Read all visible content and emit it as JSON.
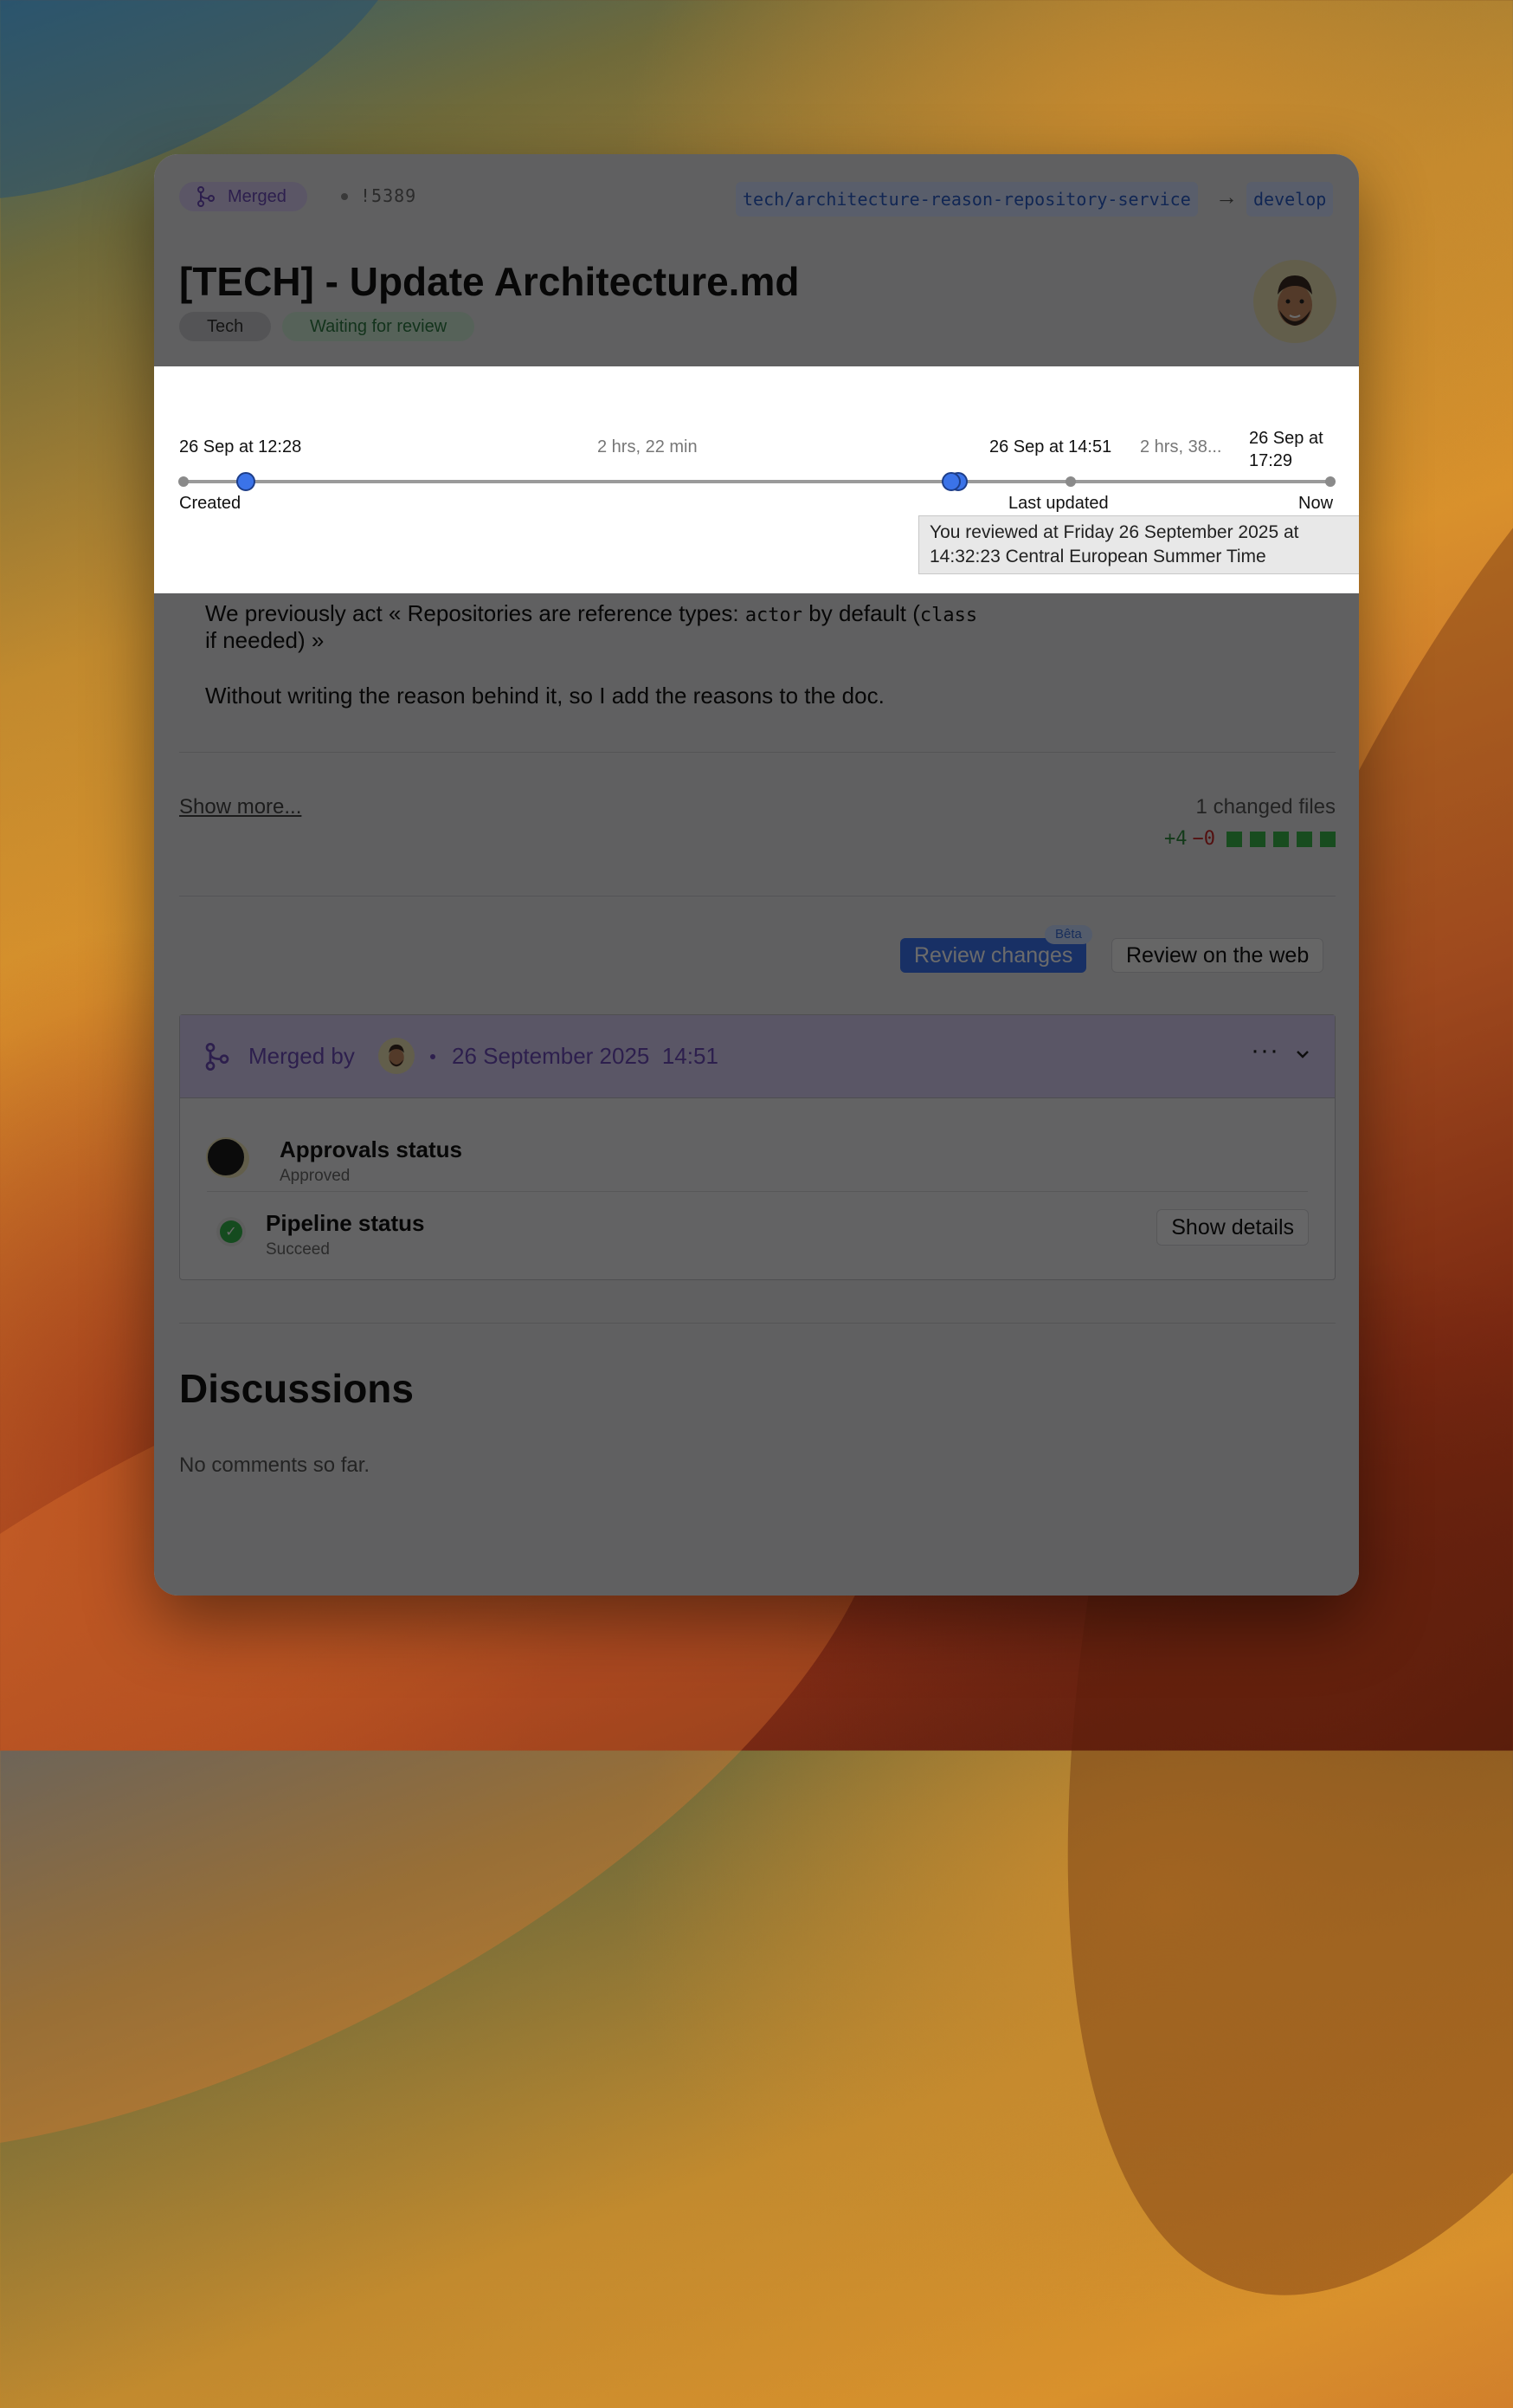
{
  "header": {
    "status": "Merged",
    "mr_id": "!5389",
    "source_branch": "tech/architecture-reason-repository-service",
    "target_branch": "develop"
  },
  "title": "[TECH] - Update Architecture.md",
  "tags": [
    "Tech",
    "Waiting for review"
  ],
  "timeline": {
    "created_time": "26 Sep at 12:28",
    "duration_1": "2 hrs, 22 min",
    "updated_time": "26 Sep at 14:51",
    "duration_2": "2 hrs, 38...",
    "now_time_line1": "26 Sep at",
    "now_time_line2": "17:29",
    "label_created": "Created",
    "label_last_updated": "Last updated",
    "label_now": "Now",
    "tooltip_line1": "You reviewed at Friday 26 September 2025 at",
    "tooltip_line2": "14:32:23 Central European Summer Time"
  },
  "description": {
    "line1_pre": "We previously act « Repositories are reference types: ",
    "line1_code1": "actor",
    "line1_mid": " by default (",
    "line1_code2": "class",
    "line2": "if needed) »",
    "paragraph2": "Without writing the reason behind it, so I add the reasons to the doc."
  },
  "files": {
    "show_more": "Show more...",
    "changed_files": "1 changed files",
    "additions": "+4",
    "deletions": "−0",
    "bar_added_blocks": 5,
    "bar_removed_blocks": 0
  },
  "actions": {
    "review_changes": "Review changes",
    "beta_badge": "Bêta",
    "review_web": "Review on the web"
  },
  "merge": {
    "merged_by": "Merged by",
    "date": "26 September 2025",
    "time": "14:51",
    "more": "···",
    "approvals_title": "Approvals status",
    "approvals_sub": "Approved",
    "pipeline_title": "Pipeline status",
    "pipeline_sub": "Succeed",
    "show_details": "Show details"
  },
  "discussions": {
    "title": "Discussions",
    "empty": "No comments so far."
  },
  "colors": {
    "accent_blue": "#3a72f0",
    "merged_purple": "#6b4bb8",
    "success_green": "#34b34a",
    "deletion_red": "#c62828"
  }
}
